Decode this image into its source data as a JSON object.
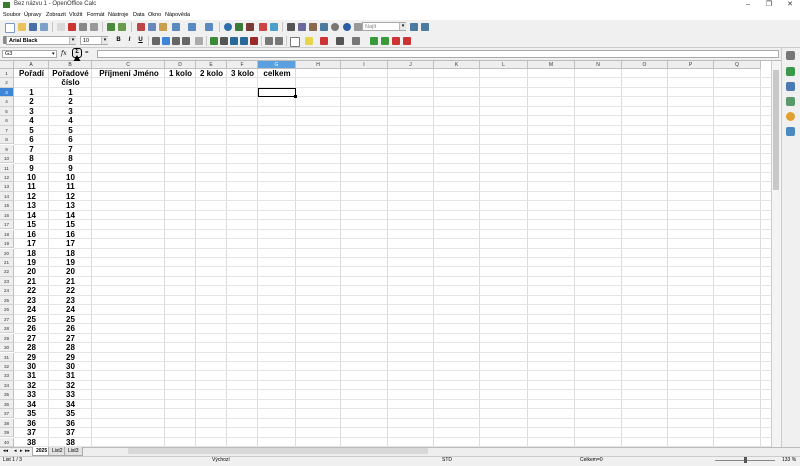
{
  "window": {
    "title": "Bez názvu 1 - OpenOffice Calc",
    "minimize": "–",
    "maximize": "❐",
    "close": "✕"
  },
  "menu": [
    "Soubor",
    "Úpravy",
    "Zobrazit",
    "Vložit",
    "Formát",
    "Nástroje",
    "Data",
    "Okno",
    "Nápověda"
  ],
  "toolbar": {
    "find_placeholder": "Najít"
  },
  "format_toolbar": {
    "font_name": "Arial Black",
    "font_size": "10",
    "bold": "B",
    "italic": "I",
    "underline": "U"
  },
  "formula_bar": {
    "name_box": "G3",
    "fx": "fx",
    "sum": "Σ",
    "equals": "="
  },
  "columns": [
    "A",
    "B",
    "C",
    "D",
    "E",
    "F",
    "G",
    "H",
    "I",
    "J",
    "K",
    "L",
    "M",
    "N",
    "O",
    "P",
    "Q"
  ],
  "selected_column": "G",
  "selected_row": "3",
  "headers": {
    "a1": "Pořadí",
    "b1": "Pořadové",
    "b2": "číslo",
    "c1": "Příjmení Jméno",
    "d1": "1 kolo",
    "e1": "2 kolo",
    "f1": "3 kolo",
    "g1": "celkem"
  },
  "rows": [
    "1",
    "2",
    "3",
    "4",
    "5",
    "6",
    "7",
    "8",
    "9",
    "10",
    "11",
    "12",
    "13",
    "14",
    "15",
    "16",
    "17",
    "18",
    "19",
    "20",
    "21",
    "22",
    "23",
    "24",
    "25",
    "26",
    "27",
    "28",
    "29",
    "30",
    "31",
    "32",
    "33",
    "34",
    "35",
    "36",
    "37",
    "38",
    "39",
    "40"
  ],
  "data_a": [
    "1",
    "2",
    "3",
    "4",
    "5",
    "6",
    "7",
    "8",
    "9",
    "10",
    "11",
    "12",
    "13",
    "14",
    "15",
    "16",
    "17",
    "18",
    "19",
    "20",
    "21",
    "22",
    "23",
    "24",
    "25",
    "26",
    "27",
    "28",
    "29",
    "30",
    "31",
    "32",
    "33",
    "34",
    "35",
    "36",
    "37",
    "38"
  ],
  "data_b": [
    "1",
    "2",
    "3",
    "4",
    "5",
    "6",
    "7",
    "8",
    "9",
    "10",
    "11",
    "12",
    "13",
    "14",
    "15",
    "16",
    "17",
    "18",
    "19",
    "20",
    "21",
    "22",
    "23",
    "24",
    "25",
    "26",
    "27",
    "28",
    "29",
    "30",
    "31",
    "32",
    "33",
    "34",
    "35",
    "36",
    "37",
    "38"
  ],
  "sheets": [
    "2025",
    "List2",
    "List3"
  ],
  "status": {
    "sheet": "List 1 / 3",
    "style": "Výchozí",
    "mode": "STD",
    "sum": "Celkem=0",
    "zoom": "133 %"
  },
  "colors": {
    "selection": "#3d85d6",
    "accent": "#5aa0e0"
  }
}
